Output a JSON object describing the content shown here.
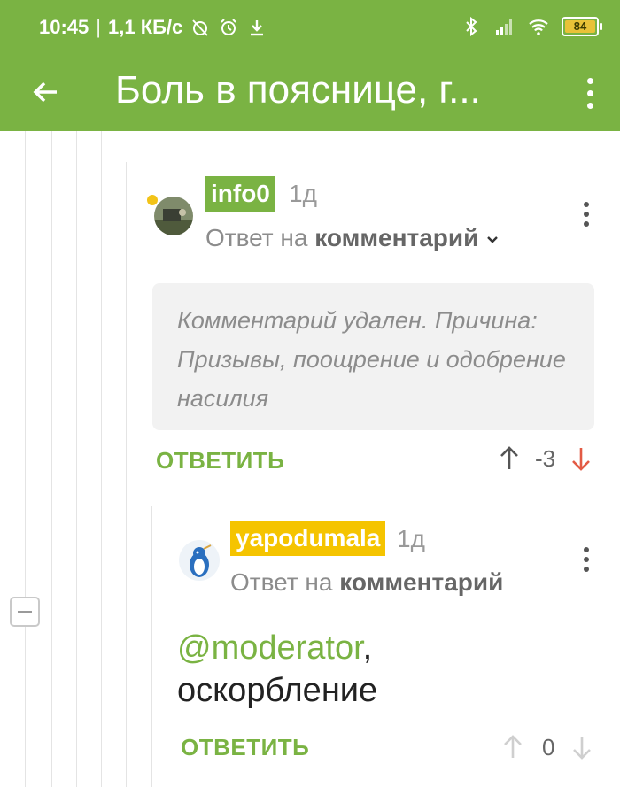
{
  "status_bar": {
    "time": "10:45",
    "speed": "1,1 КБ/с",
    "battery": "84",
    "icons": [
      "alarm-off-icon",
      "alarm-icon",
      "download-icon",
      "bluetooth-icon",
      "signal-icon",
      "wifi-icon",
      "battery-icon"
    ]
  },
  "app_bar": {
    "title": "Боль в пояснице, г...",
    "back_icon": "arrow-left-icon",
    "menu_icon": "more-vert-icon"
  },
  "comments": [
    {
      "username": "info0",
      "user_tag_color": "#7ab343",
      "time": "1д",
      "reply_prefix": "Ответ на",
      "reply_target": "комментарий",
      "deleted_text": "Комментарий удален. Причина: Призывы, поощрение и одобрение насилия",
      "reply_label": "ОТВЕТИТЬ",
      "score": "-3",
      "vote_down_color": "#e35a44"
    },
    {
      "username": "yapodumala",
      "user_tag_color": "#f5c400",
      "time": "1д",
      "reply_prefix": "Ответ на",
      "reply_target": "комментарий",
      "mention": "@moderator",
      "mention_suffix": ",",
      "text_line2": "оскорбление",
      "reply_label": "ОТВЕТИТЬ",
      "score": "0"
    }
  ],
  "colors": {
    "accent": "#7ab343",
    "warning_tag": "#f5c400"
  }
}
